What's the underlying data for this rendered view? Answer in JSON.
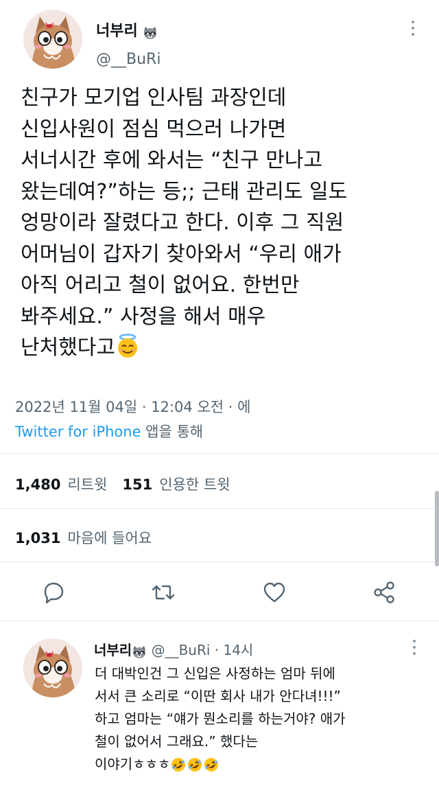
{
  "tweet": {
    "display_name": "너부리",
    "name_icon": "raccoon-emoji",
    "handle": "@__BuRi",
    "lines": [
      "친구가 모기업 인사팀 과장인데",
      "신입사원이 점심 먹으러 나가면",
      "서너시간 후에 와서는 “친구 만나고",
      "왔는데여?”하는 등;; 근태 관리도 일도",
      "엉망이라 잘렸다고 한다. 이후 그 직원",
      "어머님이 갑자기 찾아와서 “우리 애가",
      "아직 어리고 철이 없어요. 한번만",
      "봐주세요.” 사정을 해서 매우",
      "난처했다고"
    ],
    "end_emoji": "smiling-face-with-halo-emoji",
    "timestamp": "2022년 11월 04일 · 12:04 오전 · 에",
    "source_link": "Twitter for iPhone",
    "source_rest": " 앱을 통해",
    "retweets": "1,480",
    "retweets_label": "리트윗",
    "quotes": "151",
    "quotes_label": "인용한 트윗",
    "likes": "1,031",
    "likes_label": "마음에 들어요"
  },
  "actions": [
    {
      "name": "reply",
      "icon": "comment-icon"
    },
    {
      "name": "retweet",
      "icon": "retweet-icon"
    },
    {
      "name": "like",
      "icon": "heart-icon"
    },
    {
      "name": "share",
      "icon": "share-icon"
    }
  ],
  "reply": {
    "display_name": "너부리",
    "name_icon": "raccoon-emoji",
    "handle_time": "@__BuRi · 14시",
    "lines": [
      "더 대박인건 그 신입은 사정하는 엄마 뒤에",
      "서서 큰 소리로 “이딴 회사 내가 안다녀!!!”",
      "하고 엄마는 “얘가 뭔소리를 하는거야? 애가",
      "철이 없어서 그래요.” 했다는",
      "이야기ㅎㅎㅎ"
    ],
    "end_emojis": [
      "rolling-on-floor-laughing-emoji",
      "rolling-on-floor-laughing-emoji",
      "rolling-on-floor-laughing-emoji"
    ]
  },
  "colors": {
    "text": "#0f1419",
    "secondary": "#536471",
    "link": "#1d9bf0",
    "divider": "#e4e8eb"
  }
}
